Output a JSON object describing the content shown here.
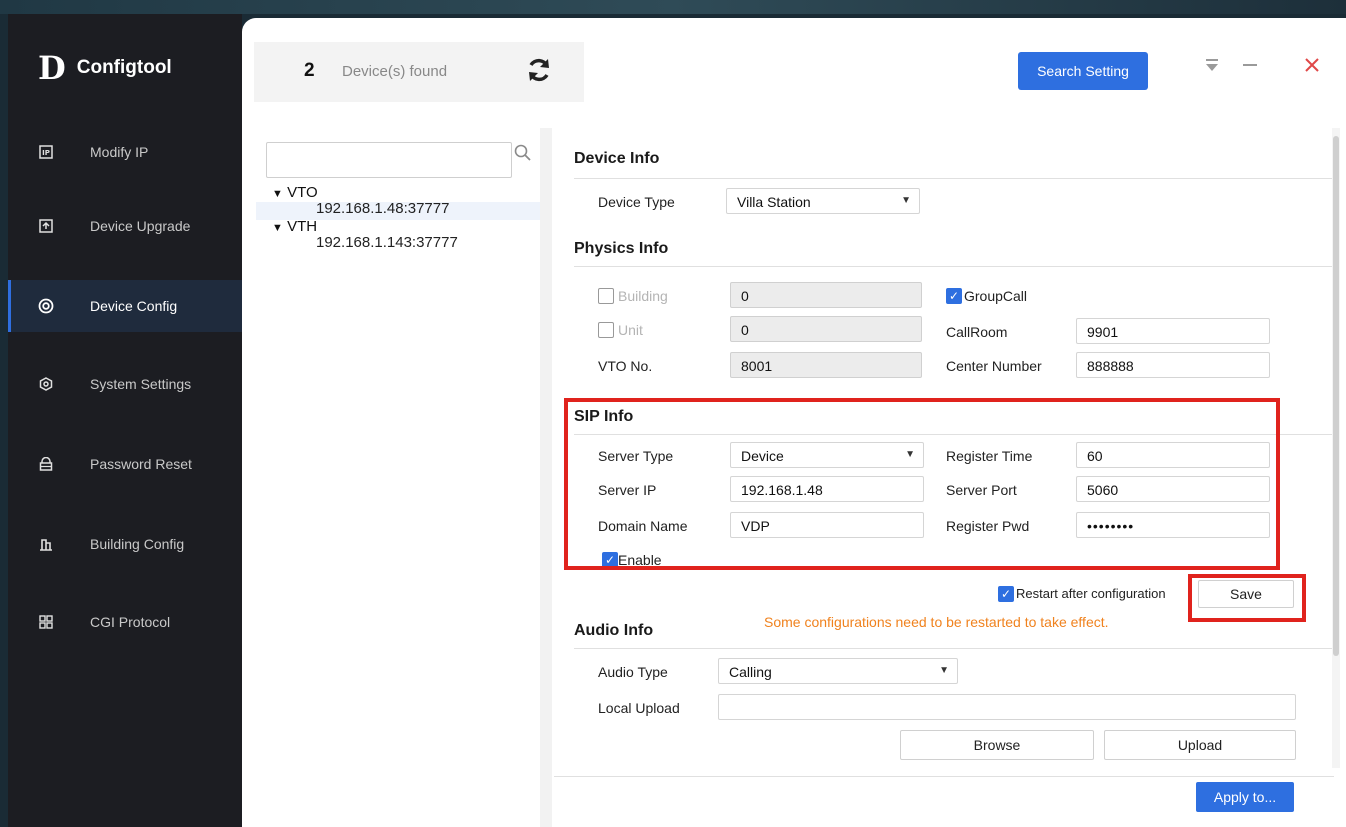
{
  "app": {
    "logo_mark": "D",
    "logo_text": "Configtool"
  },
  "sidebar": {
    "items": [
      {
        "label": "Modify IP",
        "icon": "ip-icon",
        "active": false
      },
      {
        "label": "Device Upgrade",
        "icon": "upload-icon",
        "active": false
      },
      {
        "label": "Device Config",
        "icon": "target-icon",
        "active": true
      },
      {
        "label": "System Settings",
        "icon": "hexagon-gear-icon",
        "active": false
      },
      {
        "label": "Password Reset",
        "icon": "lock-icon",
        "active": false
      },
      {
        "label": "Building Config",
        "icon": "building-icon",
        "active": false
      },
      {
        "label": "CGI Protocol",
        "icon": "grid-icon",
        "active": false
      }
    ]
  },
  "header": {
    "device_count": "2",
    "device_count_label": "Device(s) found",
    "search_setting_label": "Search Setting"
  },
  "tree": {
    "search_placeholder": "",
    "groups": [
      {
        "name": "VTO",
        "ip": "192.168.1.48:37777"
      },
      {
        "name": "VTH",
        "ip": "192.168.1.143:37777"
      }
    ]
  },
  "device_info": {
    "title": "Device Info",
    "device_type_label": "Device Type",
    "device_type_value": "Villa Station"
  },
  "physics_info": {
    "title": "Physics Info",
    "building_label": "Building",
    "building_value": "0",
    "building_checked": false,
    "unit_label": "Unit",
    "unit_value": "0",
    "unit_checked": false,
    "vto_no_label": "VTO No.",
    "vto_no_value": "8001",
    "groupcall_label": "GroupCall",
    "groupcall_checked": true,
    "callroom_label": "CallRoom",
    "callroom_value": "9901",
    "center_number_label": "Center Number",
    "center_number_value": "888888"
  },
  "sip_info": {
    "title": "SIP Info",
    "server_type_label": "Server Type",
    "server_type_value": "Device",
    "server_ip_label": "Server IP",
    "server_ip_value": "192.168.1.48",
    "domain_name_label": "Domain Name",
    "domain_name_value": "VDP",
    "register_time_label": "Register Time",
    "register_time_value": "60",
    "server_port_label": "Server Port",
    "server_port_value": "5060",
    "register_pwd_label": "Register Pwd",
    "register_pwd_value": "••••••••",
    "enable_label": "Enable",
    "enable_checked": true
  },
  "save_area": {
    "restart_label": "Restart after configuration",
    "restart_checked": true,
    "save_label": "Save",
    "warning": "Some configurations need to be restarted to take effect."
  },
  "audio_info": {
    "title": "Audio Info",
    "audio_type_label": "Audio Type",
    "audio_type_value": "Calling",
    "local_upload_label": "Local Upload",
    "local_upload_value": "",
    "browse_label": "Browse",
    "upload_label": "Upload"
  },
  "footer": {
    "apply_label": "Apply to..."
  },
  "colors": {
    "accent": "#2e6fe0",
    "highlight_box": "#e0231d",
    "warning": "#f0821e",
    "sidebar_bg": "#1c1d22"
  }
}
